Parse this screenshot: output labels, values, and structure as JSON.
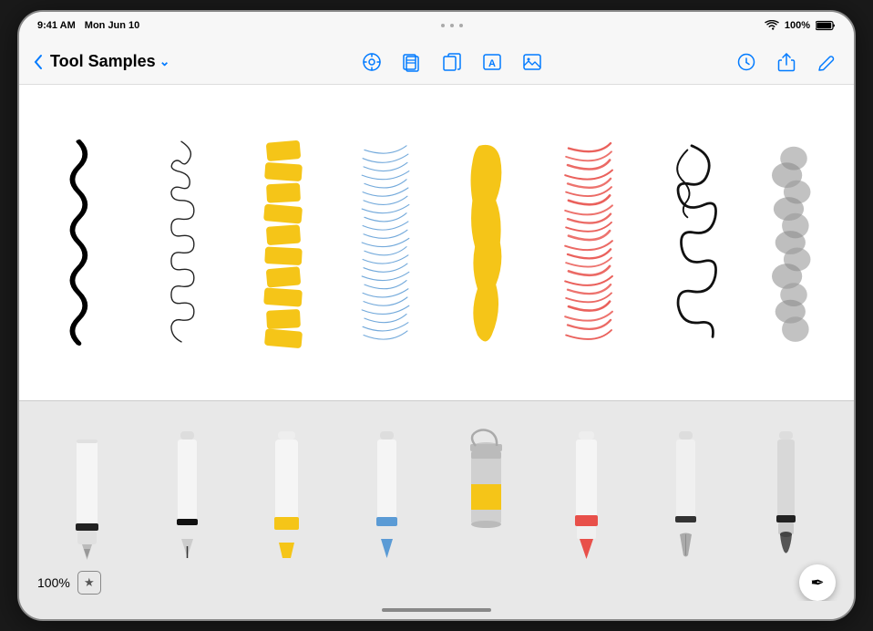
{
  "statusBar": {
    "time": "9:41 AM",
    "date": "Mon Jun 10",
    "dots": [
      "•",
      "•",
      "•"
    ],
    "battery": "100%",
    "batteryColor": "#000"
  },
  "toolbar": {
    "backLabel": "‹",
    "title": "Tool Samples",
    "titleChevron": "⌄",
    "centerIcons": [
      {
        "name": "markup-icon",
        "glyph": "⊙",
        "label": "Markup"
      },
      {
        "name": "pages-icon",
        "glyph": "⊞",
        "label": "Pages"
      },
      {
        "name": "copy-icon",
        "glyph": "⊡",
        "label": "Copy"
      },
      {
        "name": "text-icon",
        "glyph": "A",
        "label": "Text"
      },
      {
        "name": "image-icon",
        "glyph": "⊟",
        "label": "Image"
      }
    ],
    "rightIcons": [
      {
        "name": "history-icon",
        "glyph": "⊘",
        "label": "History"
      },
      {
        "name": "share-icon",
        "glyph": "↑",
        "label": "Share"
      },
      {
        "name": "edit-icon",
        "glyph": "✎",
        "label": "Edit"
      }
    ]
  },
  "strokes": [
    {
      "id": "pen-squiggle",
      "color": "#000000",
      "type": "squiggle"
    },
    {
      "id": "pen-loops",
      "color": "#333333",
      "type": "loops"
    },
    {
      "id": "marker-wide",
      "color": "#F5C518",
      "type": "marker-wide"
    },
    {
      "id": "pencil-scribble",
      "color": "#5B9BD5",
      "type": "pencil"
    },
    {
      "id": "marker-fill",
      "color": "#F5C518",
      "type": "blob"
    },
    {
      "id": "crayon-scribble",
      "color": "#E8504A",
      "type": "crayon"
    },
    {
      "id": "ink-flourish",
      "color": "#222222",
      "type": "flourish"
    },
    {
      "id": "brush-smoke",
      "color": "#888888",
      "type": "smoke"
    }
  ],
  "tools": [
    {
      "name": "fountain-pen",
      "bodyColor": "#f0f0f0",
      "bandColor": "#222222",
      "tipColor": "#222222"
    },
    {
      "name": "technical-pen",
      "bodyColor": "#f0f0f0",
      "bandColor": "#111111",
      "tipColor": "#111111"
    },
    {
      "name": "marker",
      "bodyColor": "#f0f0f0",
      "bandColor": "#F5C518",
      "tipColor": "#F5C518"
    },
    {
      "name": "felt-pen",
      "bodyColor": "#f0f0f0",
      "bandColor": "#5B9BD5",
      "tipColor": "#5B9BD5"
    },
    {
      "name": "paint-can",
      "bodyColor": "#d0d0d0",
      "bandColor": "#F5C518",
      "tipColor": "#aaa"
    },
    {
      "name": "crayon",
      "bodyColor": "#f0f0f0",
      "bandColor": "#E8504A",
      "tipColor": "#E8504A"
    },
    {
      "name": "calligraphy-pen",
      "bodyColor": "#f0f0f0",
      "bandColor": "#222222",
      "tipColor": "#222222"
    },
    {
      "name": "brush",
      "bodyColor": "#d0d0d0",
      "bandColor": "#222222",
      "tipColor": "#555555"
    }
  ],
  "bottomBar": {
    "zoom": "100%",
    "starLabel": "★",
    "penLabel": "✒"
  },
  "colors": {
    "accent": "#007AFF",
    "background": "#f7f7f7",
    "canvasBg": "#ffffff",
    "panelBg": "#e8e8e8"
  }
}
